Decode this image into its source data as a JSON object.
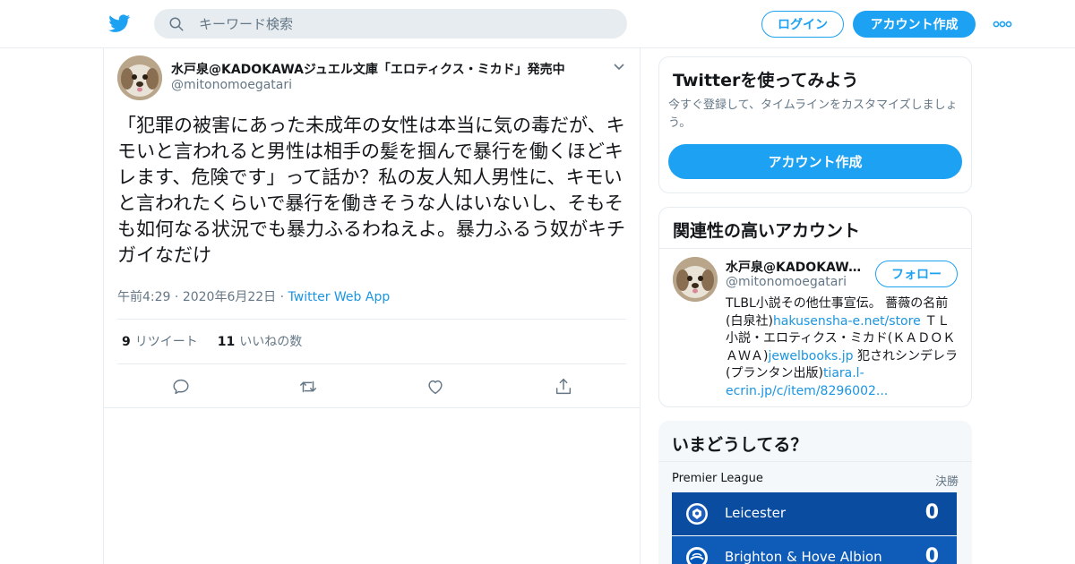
{
  "header": {
    "search_placeholder": "キーワード検索",
    "login_label": "ログイン",
    "signup_label": "アカウント作成"
  },
  "tweet": {
    "author_name": "水戸泉@KADOKAWAジュエル文庫「エロティクス・ミカド」発売中",
    "author_handle": "@mitonomoegatari",
    "text": "「犯罪の被害にあった未成年の女性は本当に気の毒だが、キモいと言われると男性は相手の髪を掴んで暴行を働くほどキレます、危険です」って話か？私の友人知人男性に、キモいと言われたくらいで暴行を働きそうな人はいないし、そもそも如何なる状況でも暴力ふるわねえよ。暴力ふるう奴がキチガイなだけ",
    "time": "午前4:29",
    "date": "2020年6月22日",
    "client": "Twitter Web App",
    "retweet_count": "9",
    "retweet_label": "リツイート",
    "like_count": "11",
    "like_label": "いいねの数"
  },
  "sidebar": {
    "signup_card": {
      "title": "Twitterを使ってみよう",
      "description": "今すぐ登録して、タイムラインをカスタマイズしましょう。",
      "button_label": "アカウント作成"
    },
    "related": {
      "title": "関連性の高いアカウント",
      "name": "水戸泉@KADOKAWA...",
      "handle": "@mitonomoegatari",
      "follow_label": "フォロー",
      "bio_1": "TLBL小説その他仕事宣伝。 薔薇の名前(白泉社)",
      "bio_link_1": "hakusensha-e.net/store",
      "bio_2": " ＴＬ小説・エロティクス・ミカド(ＫＡＤＯＫＡＷＡ)",
      "bio_link_2": "jewelbooks.jp",
      "bio_3": " 犯されシンデレラ(プランタン出版)",
      "bio_link_3": "tiara.l-ecrin.jp/c/item/8296002..."
    },
    "trends": {
      "title": "いまどうしてる？",
      "league": "Premier League",
      "status": "決勝",
      "teams": [
        {
          "name": "Leicester",
          "score": "0"
        },
        {
          "name": "Brighton & Hove Albion",
          "score": "0"
        }
      ]
    }
  },
  "colors": {
    "brand_blue": "#1da1f2",
    "link_blue": "#1b95e0",
    "secondary_text": "#657786",
    "border": "#e6ecf0"
  },
  "icons": [
    "twitter-logo-icon",
    "search-icon",
    "more-icon",
    "chevron-down-icon",
    "reply-icon",
    "retweet-icon",
    "like-icon",
    "share-icon",
    "team-crest-icon"
  ]
}
